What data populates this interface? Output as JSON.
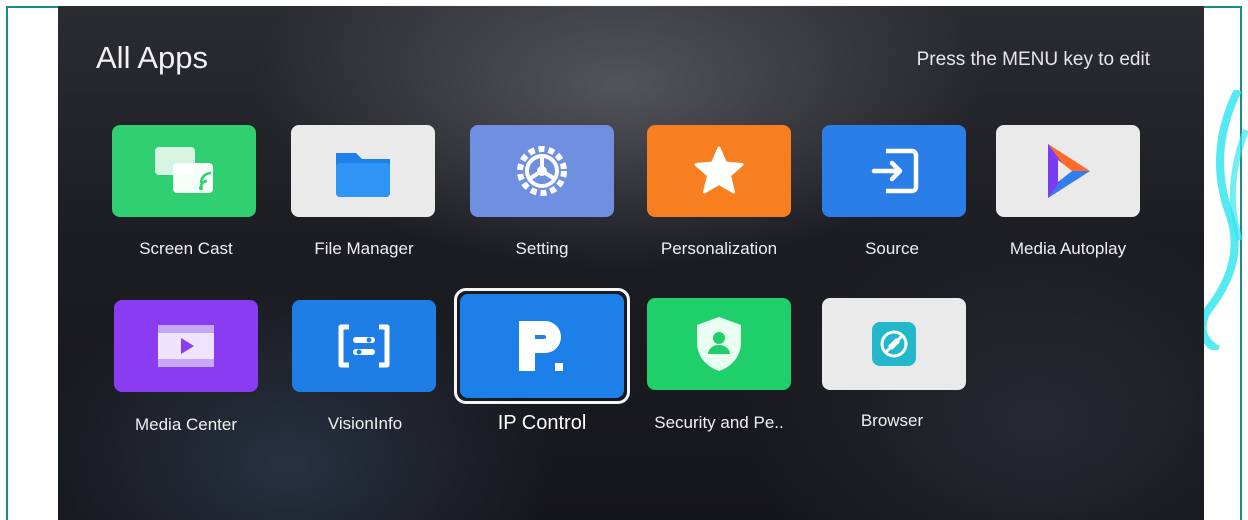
{
  "header": {
    "title": "All Apps",
    "hint": "Press the MENU key to edit"
  },
  "apps": [
    {
      "label": "Screen Cast",
      "icon": "screen-cast-icon",
      "color": "#2fcf72"
    },
    {
      "label": "File Manager",
      "icon": "folder-icon",
      "color": "#eaeaea"
    },
    {
      "label": "Setting",
      "icon": "gear-icon",
      "color": "#6f8fe0"
    },
    {
      "label": "Personalization",
      "icon": "star-icon",
      "color": "#f77f1f"
    },
    {
      "label": "Source",
      "icon": "input-source-icon",
      "color": "#2b7de8"
    },
    {
      "label": "Media Autoplay",
      "icon": "play-logo-icon",
      "color": "#eaeaea"
    },
    {
      "label": "Media Center",
      "icon": "film-play-icon",
      "color": "#8a3cf0"
    },
    {
      "label": "VisionInfo",
      "icon": "vision-info-icon",
      "color": "#1f7ee6"
    },
    {
      "label": "IP Control",
      "icon": "p-logo-icon",
      "color": "#1d7fe8",
      "focused": true
    },
    {
      "label": "Security and Pe..",
      "icon": "shield-user-icon",
      "color": "#1fcf6a"
    },
    {
      "label": "Browser",
      "icon": "browser-globe-icon",
      "color": "#eaeaea"
    }
  ]
}
